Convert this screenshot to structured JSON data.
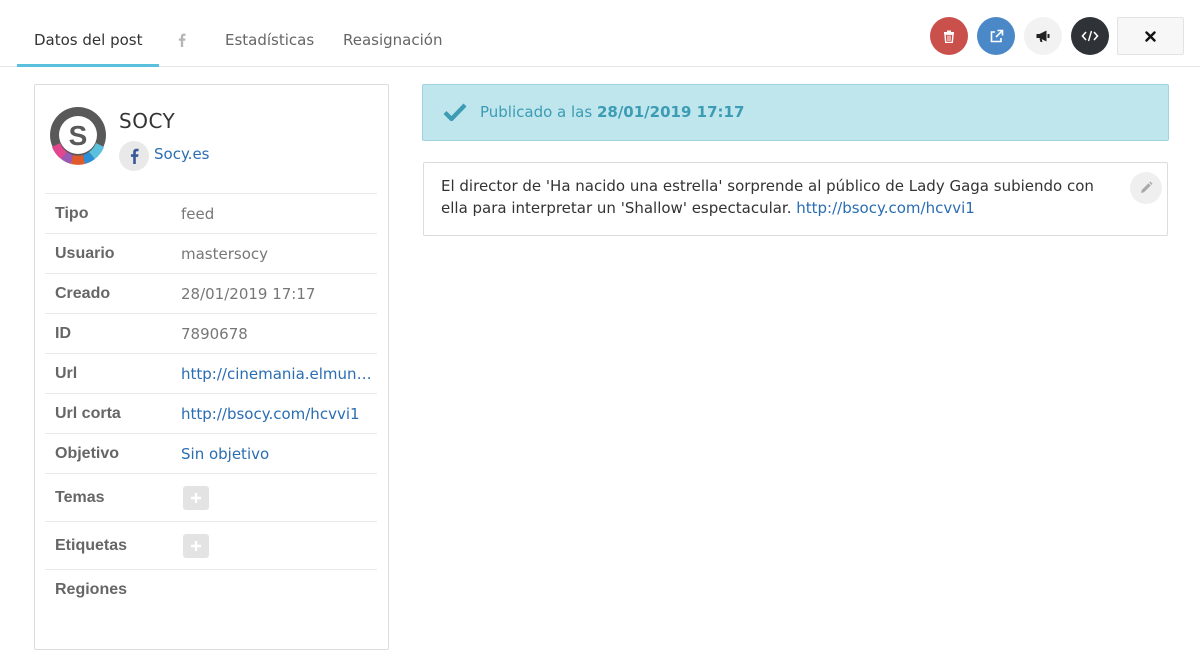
{
  "tabs": {
    "post_data": "Datos del post",
    "facebook": "facebook-icon",
    "stats": "Estadísticas",
    "reassign": "Reasignación"
  },
  "header_buttons": [
    {
      "name": "delete",
      "icon": "trash-icon",
      "color": "#c9504b"
    },
    {
      "name": "open-external",
      "icon": "external-link-icon",
      "color": "#4a88c7"
    },
    {
      "name": "promote",
      "icon": "megaphone-icon",
      "color": "#f2f2f2"
    },
    {
      "name": "embed-code",
      "icon": "code-icon",
      "color": "#2f3337"
    },
    {
      "name": "close",
      "icon": "close-icon",
      "color": "#f7f7f7"
    }
  ],
  "account": {
    "name": "SOCY",
    "network_icon": "facebook-icon",
    "page": "Socy.es"
  },
  "info": {
    "tipo": {
      "label": "Tipo",
      "value": "feed"
    },
    "usuario": {
      "label": "Usuario",
      "value": "mastersocy"
    },
    "creado": {
      "label": "Creado",
      "value": "28/01/2019 17:17"
    },
    "id": {
      "label": "ID",
      "value": "7890678"
    },
    "url": {
      "label": "Url",
      "value": "http://cinemania.elmundo.es/"
    },
    "url_corta": {
      "label": "Url corta",
      "value": "http://bsocy.com/hcvvi1"
    },
    "objetivo": {
      "label": "Objetivo",
      "value": "Sin objetivo"
    },
    "temas": {
      "label": "Temas"
    },
    "etiquetas": {
      "label": "Etiquetas"
    },
    "regiones": {
      "label": "Regiones"
    }
  },
  "status": {
    "prefix": "Publicado a las ",
    "datetime": "28/01/2019 17:17"
  },
  "post": {
    "text": "El director de 'Ha nacido una estrella' sorprende al público de Lady Gaga subiendo con ella para interpretar un 'Shallow' espectacular. ",
    "link": "http://bsocy.com/hcvvi1"
  }
}
